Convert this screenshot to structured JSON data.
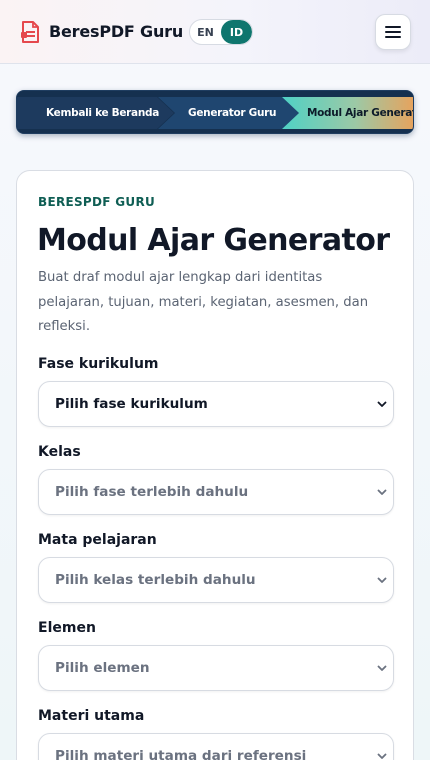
{
  "header": {
    "brand": "BeresPDF Guru",
    "languages": [
      {
        "code": "EN",
        "active": false
      },
      {
        "code": "ID",
        "active": true
      }
    ],
    "menu_icon": "hamburger-menu-icon",
    "logo_icon": "pdf-document-icon",
    "logo_color": "#e5484d"
  },
  "breadcrumb": {
    "items": [
      "Kembali ke Beranda",
      "Generator Guru",
      "Modul Ajar Generator"
    ]
  },
  "form": {
    "eyebrow": "BERESPDF GURU",
    "title": "Modul Ajar Generator",
    "description": "Buat draf modul ajar lengkap dari identitas pelajaran, tujuan, materi, kegiatan, asesmen, dan refleksi.",
    "fields": [
      {
        "label": "Fase kurikulum",
        "value": "Pilih fase kurikulum"
      },
      {
        "label": "Kelas",
        "value": "Pilih fase terlebih dahulu"
      },
      {
        "label": "Mata pelajaran",
        "value": "Pilih kelas terlebih dahulu"
      },
      {
        "label": "Elemen",
        "value": "Pilih elemen"
      },
      {
        "label": "Materi utama",
        "value": "Pilih materi utama dari referensi"
      }
    ]
  },
  "colors": {
    "accent": "#0f766e",
    "breadcrumb_bg": "#15304f",
    "active_crumb_start": "#4fd1c5",
    "active_crumb_end": "#e8a25c"
  }
}
